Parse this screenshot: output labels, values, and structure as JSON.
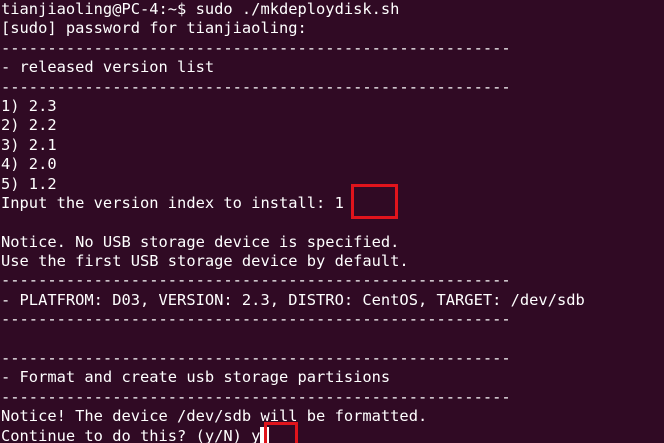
{
  "terminal": {
    "lines": [
      "tianjiaoling@PC-4:~$ sudo ./mkdeploydisk.sh",
      "[sudo] password for tianjiaoling:",
      "-------------------------------------------------------",
      "- released version list",
      "-------------------------------------------------------",
      "1) 2.3",
      "2) 2.2",
      "3) 2.1",
      "4) 2.0",
      "5) 1.2",
      "Input the version index to install: 1",
      "",
      "Notice. No USB storage device is specified.",
      "Use the first USB storage device by default.",
      "-------------------------------------------------------",
      "- PLATFROM: D03, VERSION: 2.3, DISTRO: CentOS, TARGET: /dev/sdb",
      "-------------------------------------------------------",
      "",
      "-------------------------------------------------------",
      "- Format and create usb storage partisions",
      "-------------------------------------------------------",
      "Notice! The device /dev/sdb will be formatted.",
      "Continue to do this? (y/N) y"
    ]
  },
  "colors": {
    "background": "#300a24",
    "foreground": "#ffffff",
    "highlight": "#e0141c"
  }
}
